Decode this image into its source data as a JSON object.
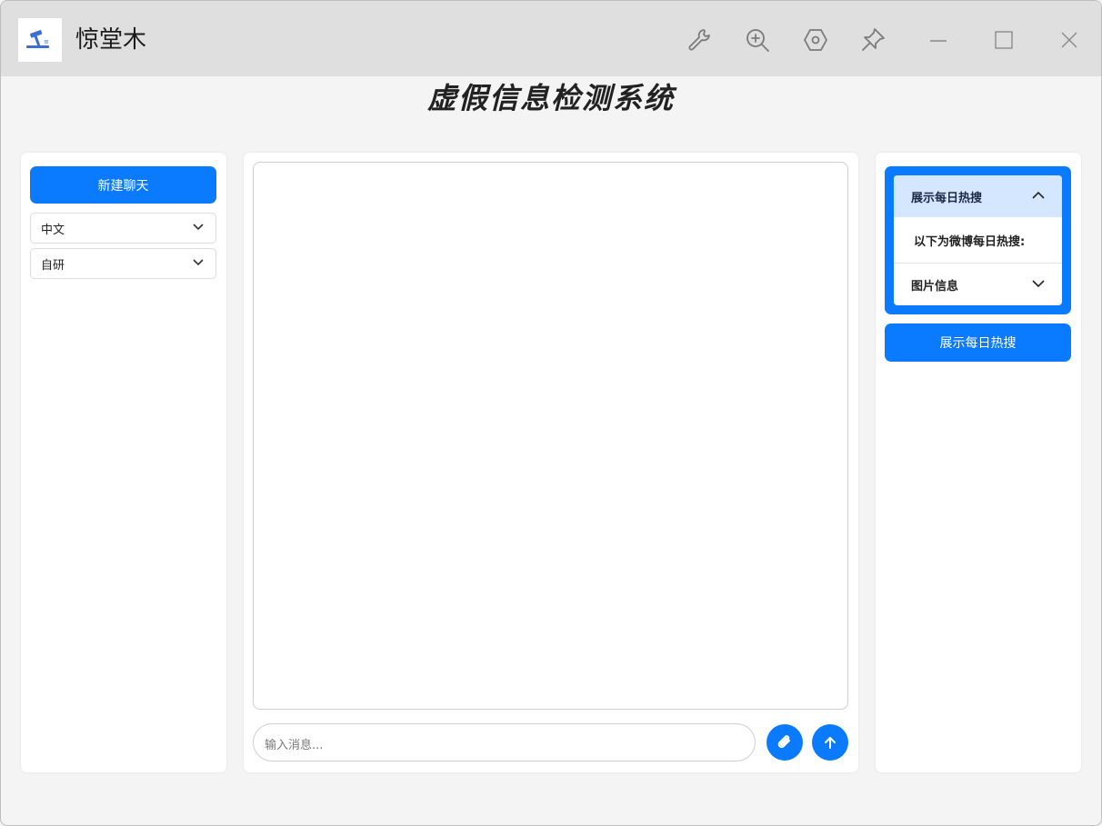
{
  "window": {
    "title": "惊堂木",
    "toolbar_icons": [
      "wrench-icon",
      "zoom-in-icon",
      "hexagon-settings-icon",
      "pin-icon"
    ],
    "controls": [
      "minimize-icon",
      "maximize-icon",
      "close-icon"
    ]
  },
  "page": {
    "title": "虚假信息检测系统"
  },
  "left_panel": {
    "new_chat_label": "新建聊天",
    "language_select": {
      "value": "中文"
    },
    "model_select": {
      "value": "自研"
    }
  },
  "chat": {
    "input_placeholder": "输入消息...",
    "attach_icon": "paperclip-icon",
    "send_icon": "arrow-up-icon"
  },
  "right_panel": {
    "accordion": {
      "header_label": "展示每日热搜",
      "body_text": "以下为微博每日热搜:",
      "second_label": "图片信息"
    },
    "show_hot_button_label": "展示每日热搜"
  },
  "colors": {
    "accent": "#0a7bff",
    "accordion_header": "#d5e6ff",
    "titlebar": "#dfdfdf",
    "background": "#f4f4f4"
  }
}
